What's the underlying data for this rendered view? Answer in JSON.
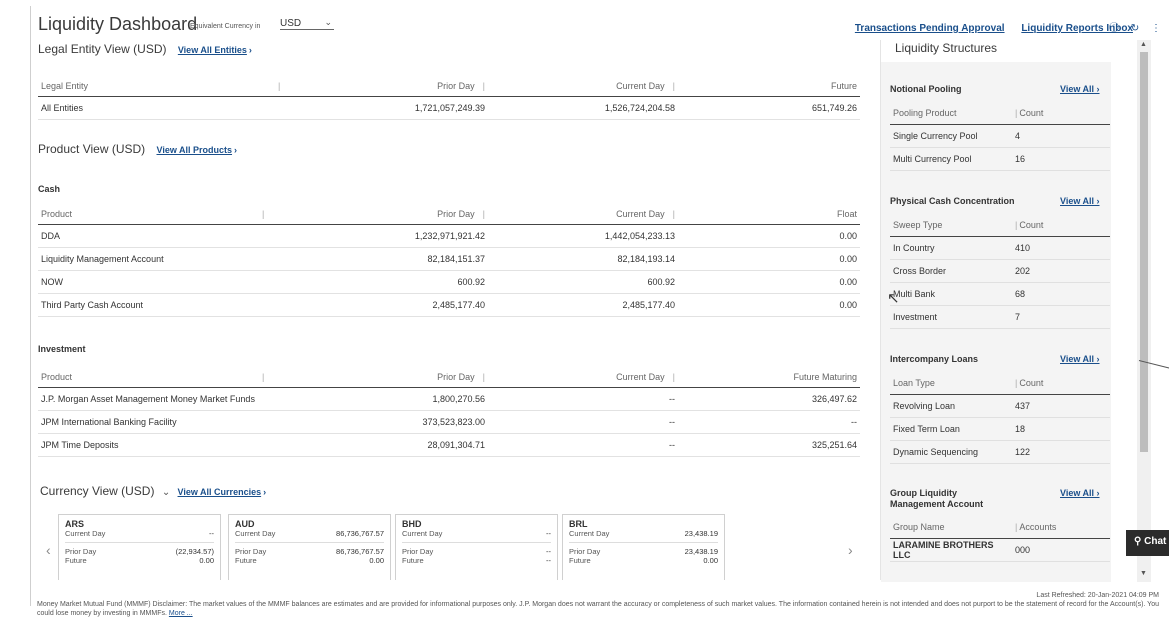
{
  "header": {
    "title": "Liquidity Dashboard",
    "currency_label": "Equivalent Currency in",
    "currency_value": "USD",
    "links": [
      "Transactions Pending Approval",
      "Liquidity Reports Inbox"
    ]
  },
  "legal_entity": {
    "title": "Legal Entity View (USD)",
    "link": "View All Entities",
    "columns": [
      "Legal Entity",
      "Prior Day",
      "Current Day",
      "Future"
    ],
    "rows": [
      [
        "All Entities",
        "1,721,057,249.39",
        "1,526,724,204.58",
        "651,749.26"
      ]
    ]
  },
  "product_view": {
    "title": "Product View (USD)",
    "link": "View All Products",
    "cash": {
      "title": "Cash",
      "columns": [
        "Product",
        "Prior Day",
        "Current Day",
        "Float"
      ],
      "rows": [
        [
          "DDA",
          "1,232,971,921.42",
          "1,442,054,233.13",
          "0.00"
        ],
        [
          "Liquidity Management Account",
          "82,184,151.37",
          "82,184,193.14",
          "0.00"
        ],
        [
          "NOW",
          "600.92",
          "600.92",
          "0.00"
        ],
        [
          "Third Party Cash Account",
          "2,485,177.40",
          "2,485,177.40",
          "0.00"
        ]
      ]
    },
    "investment": {
      "title": "Investment",
      "columns": [
        "Product",
        "Prior Day",
        "Current Day",
        "Future Maturing"
      ],
      "rows": [
        [
          "J.P. Morgan Asset Management Money Market Funds",
          "1,800,270.56",
          "--",
          "326,497.62"
        ],
        [
          "JPM International Banking Facility",
          "373,523,823.00",
          "--",
          "--"
        ],
        [
          "JPM Time Deposits",
          "28,091,304.71",
          "--",
          "325,251.64"
        ]
      ]
    }
  },
  "currency_view": {
    "title": "Currency View (USD)",
    "link": "View All Currencies",
    "cards": [
      {
        "code": "ARS",
        "current": "--",
        "prior": "(22,934.57)",
        "future": "0.00"
      },
      {
        "code": "AUD",
        "current": "86,736,767.57",
        "prior": "86,736,767.57",
        "future": "0.00"
      },
      {
        "code": "BHD",
        "current": "--",
        "prior": "--",
        "future": "--"
      },
      {
        "code": "BRL",
        "current": "23,438.19",
        "prior": "23,438.19",
        "future": "0.00"
      }
    ],
    "labels": {
      "current": "Current Day",
      "prior": "Prior Day",
      "future": "Future"
    }
  },
  "liquidity_structures": {
    "title": "Liquidity Structures",
    "view_all": "View All",
    "sections": [
      {
        "name": "Notional Pooling",
        "col1": "Pooling Product",
        "col2": "Count",
        "rows": [
          [
            "Single Currency Pool",
            "4"
          ],
          [
            "Multi Currency Pool",
            "16"
          ]
        ]
      },
      {
        "name": "Physical Cash Concentration",
        "col1": "Sweep Type",
        "col2": "Count",
        "rows": [
          [
            "In Country",
            "410"
          ],
          [
            "Cross Border",
            "202"
          ],
          [
            "Multi Bank",
            "68"
          ],
          [
            "Investment",
            "7"
          ]
        ]
      },
      {
        "name": "Intercompany Loans",
        "col1": "Loan Type",
        "col2": "Count",
        "rows": [
          [
            "Revolving Loan",
            "437"
          ],
          [
            "Fixed Term Loan",
            "18"
          ],
          [
            "Dynamic Sequencing",
            "122"
          ]
        ]
      },
      {
        "name": "Group Liquidity Management Account",
        "col1": "Group Name",
        "col2": "Accounts",
        "rows": [
          [
            "LARAMINE BROTHERS LLC",
            "000"
          ]
        ]
      }
    ]
  },
  "footer": {
    "refreshed": "Last Refreshed: 20-Jan-2021 04:09 PM",
    "disclaimer": "Money Market Mutual Fund (MMMF) Disclaimer: The market values of the MMMF balances are estimates and are provided for informational purposes only. J.P. Morgan does not warrant the accuracy or completeness of such market values. The information contained herein is not intended and does not purport to be the statement of record for the Account(s). You could lose money by investing in MMMFs.",
    "more": "More ..."
  },
  "chat": {
    "label": "Chat"
  },
  "colors": {
    "link": "#1a4f8b",
    "chat_bg": "#2b2b2b"
  }
}
